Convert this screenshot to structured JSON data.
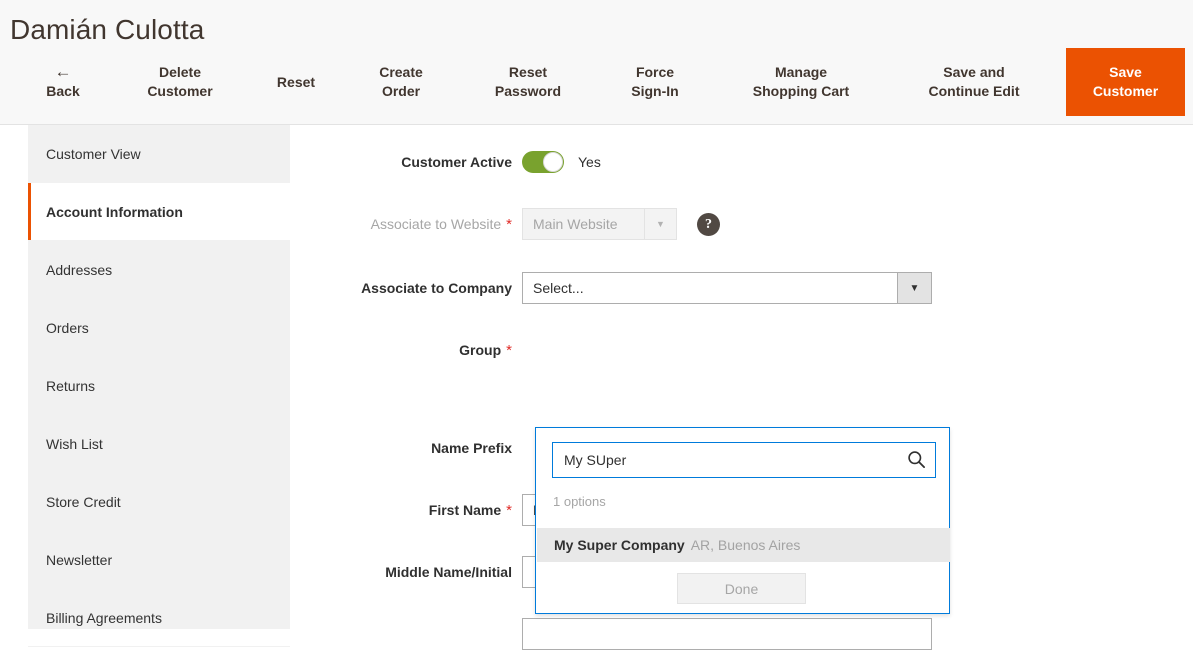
{
  "header": {
    "title": "Damián Culotta",
    "toolbar_buttons": [
      {
        "name": "back",
        "lines": [
          "Back"
        ],
        "icon": "arrow-left-icon"
      },
      {
        "name": "delete-customer",
        "lines": [
          "Delete",
          "Customer"
        ]
      },
      {
        "name": "reset",
        "lines": [
          "Reset"
        ]
      },
      {
        "name": "create-order",
        "lines": [
          "Create",
          "Order"
        ]
      },
      {
        "name": "reset-password",
        "lines": [
          "Reset",
          "Password"
        ]
      },
      {
        "name": "force-sign-in",
        "lines": [
          "Force",
          "Sign-In"
        ]
      },
      {
        "name": "manage-shopping-cart",
        "lines": [
          "Manage",
          "Shopping Cart"
        ]
      },
      {
        "name": "save-and-continue-edit",
        "lines": [
          "Save and",
          "Continue Edit"
        ]
      }
    ],
    "save_button": {
      "lines": [
        "Save",
        "Customer"
      ],
      "color": "#eb5202"
    }
  },
  "sidebar": {
    "items": [
      {
        "label": "Customer View",
        "current": false
      },
      {
        "label": "Account Information",
        "current": true
      },
      {
        "label": "Addresses",
        "current": false
      },
      {
        "label": "Orders",
        "current": false
      },
      {
        "label": "Returns",
        "current": false
      },
      {
        "label": "Wish List",
        "current": false
      },
      {
        "label": "Store Credit",
        "current": false
      },
      {
        "label": "Newsletter",
        "current": false
      },
      {
        "label": "Billing Agreements",
        "current": false
      }
    ],
    "active_marker_color": "#eb5202"
  },
  "form": {
    "customer_active": {
      "label": "Customer Active",
      "value": "Yes",
      "toggle_on": true,
      "toggle_color": "#79a22e"
    },
    "associate_to_website": {
      "label": "Associate to Website",
      "required": true,
      "value": "Main Website",
      "disabled": true
    },
    "associate_to_company": {
      "label": "Associate to Company",
      "required": false,
      "value": "Select...",
      "dropdown_open": true
    },
    "group": {
      "label": "Group",
      "required": true
    },
    "name_prefix": {
      "label": "Name Prefix",
      "required": false,
      "value": ""
    },
    "first_name": {
      "label": "First Name",
      "required": true,
      "value": "Damián"
    },
    "middle_name": {
      "label": "Middle Name/Initial",
      "required": false,
      "value": ""
    },
    "last_name": {
      "label": "",
      "required": false,
      "value": ""
    }
  },
  "company_dropdown": {
    "search_value": "My SUper",
    "search_placeholder": "",
    "options_count_label": "1 options",
    "options": [
      {
        "name": "My Super Company",
        "location": "AR, Buenos Aires",
        "highlighted": true
      }
    ],
    "done_label": "Done",
    "border_color": "#007bdb"
  },
  "icons": {
    "help": "?",
    "chevron_down": "▼",
    "back_arrow": "←"
  }
}
